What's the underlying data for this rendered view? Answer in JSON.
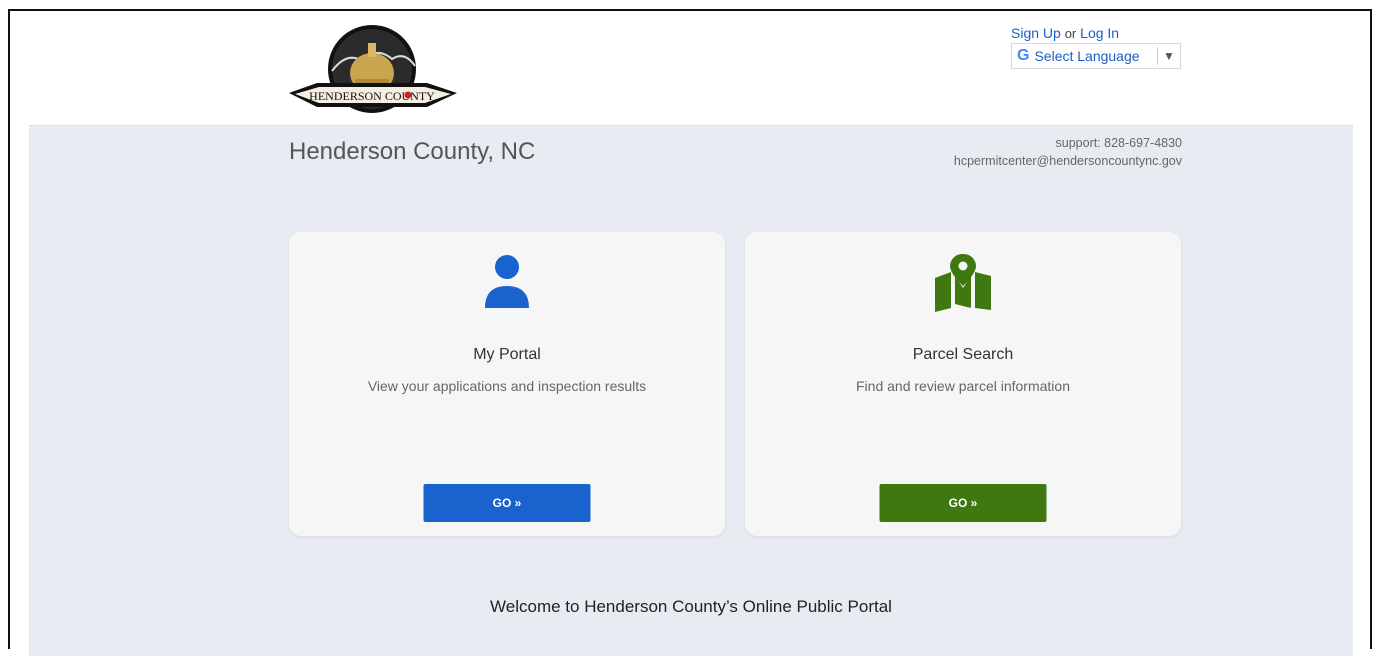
{
  "header": {
    "logo_text": "HENDERSON COUNTY",
    "signup_label": "Sign Up",
    "or_text": "or",
    "login_label": "Log In",
    "language": {
      "g_glyph": "G",
      "label": "Select Language",
      "arrow": "▼"
    }
  },
  "subheader": {
    "county_name": "Henderson County, NC",
    "support_phone": "support: 828-697-4830",
    "support_email": "hcpermitcenter@hendersoncountync.gov"
  },
  "cards": [
    {
      "title": "My Portal",
      "description": "View your applications and inspection results",
      "button_label": "GO »",
      "icon": "person-icon",
      "color": "#1a63cf"
    },
    {
      "title": "Parcel Search",
      "description": "Find and review parcel information",
      "button_label": "GO »",
      "icon": "map-pin-icon",
      "color": "#3f7710"
    }
  ],
  "welcome": "Welcome to Henderson County’s Online Public Portal"
}
